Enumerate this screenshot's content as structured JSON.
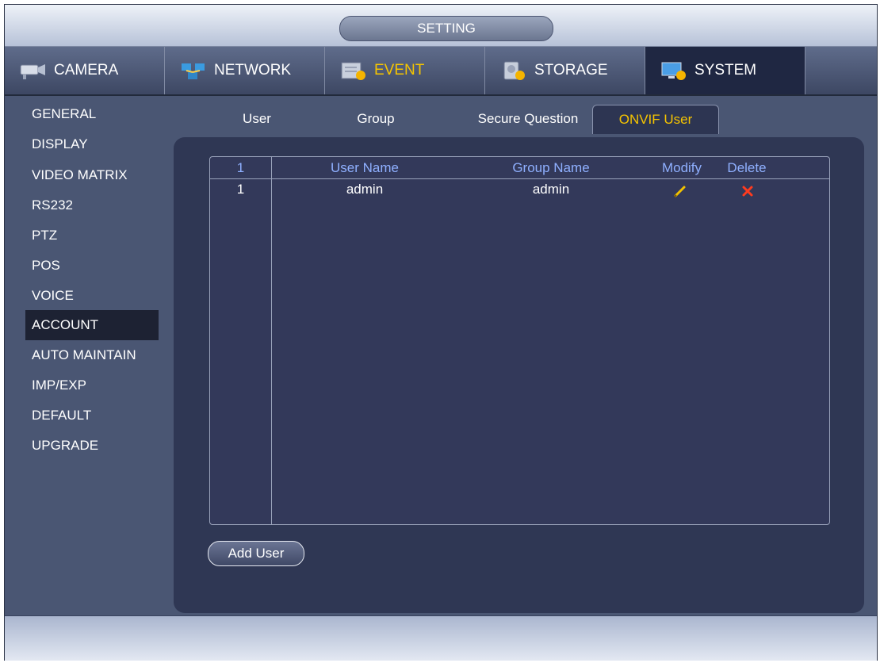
{
  "window": {
    "title": "SETTING"
  },
  "topnav": [
    {
      "label": "CAMERA",
      "icon": "camera-icon"
    },
    {
      "label": "NETWORK",
      "icon": "network-icon"
    },
    {
      "label": "EVENT",
      "icon": "event-icon"
    },
    {
      "label": "STORAGE",
      "icon": "storage-icon"
    },
    {
      "label": "SYSTEM",
      "icon": "system-icon",
      "active": true
    }
  ],
  "sidebar": {
    "items": [
      "GENERAL",
      "DISPLAY",
      "VIDEO MATRIX",
      "RS232",
      "PTZ",
      "POS",
      "VOICE",
      "ACCOUNT",
      "AUTO MAINTAIN",
      "IMP/EXP",
      "DEFAULT",
      "UPGRADE"
    ],
    "active": "ACCOUNT"
  },
  "subtabs": [
    "User",
    "Group",
    "Secure Question",
    "ONVIF User"
  ],
  "active_subtab": "ONVIF User",
  "table": {
    "headers": {
      "index": "1",
      "user_name": "User Name",
      "group_name": "Group Name",
      "modify": "Modify",
      "delete": "Delete"
    },
    "rows": [
      {
        "index": "1",
        "user_name": "admin",
        "group_name": "admin"
      }
    ]
  },
  "add_user_label": "Add User",
  "colors": {
    "accent": "#f5c400",
    "header_text": "#8fb0ff",
    "delete": "#ff3b1f"
  }
}
